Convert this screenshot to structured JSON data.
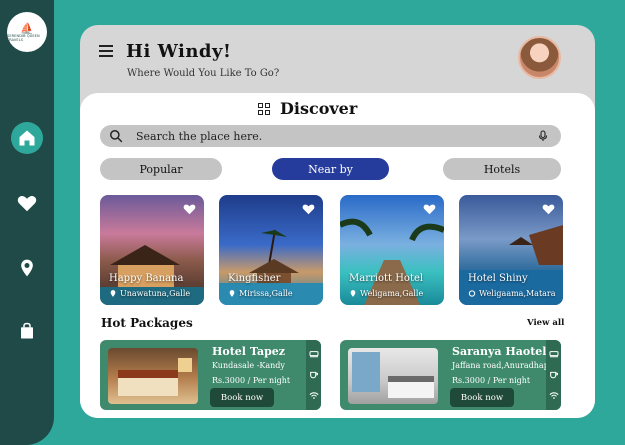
{
  "app": {
    "logo_text": "SERENDIB QUEEN TRAVELS",
    "logo_glyph": "⛵"
  },
  "sidebar": {
    "items": [
      {
        "name": "home-icon",
        "active": true
      },
      {
        "name": "heart-icon",
        "active": false
      },
      {
        "name": "location-icon",
        "active": false
      },
      {
        "name": "bag-icon",
        "active": false
      }
    ]
  },
  "header": {
    "greeting": "Hi  Windy!",
    "subtitle": "Where Would You Like To Go?"
  },
  "discover": {
    "title": "Discover"
  },
  "search": {
    "placeholder": "Search the place here."
  },
  "tabs": [
    {
      "label": "Popular",
      "active": false
    },
    {
      "label": "Near by",
      "active": true
    },
    {
      "label": "Hotels",
      "active": false
    }
  ],
  "places": [
    {
      "name": "Happy Banana",
      "location": "Unawatuna,Galle"
    },
    {
      "name": "Kingfisher",
      "location": "Mirissa,Galle"
    },
    {
      "name": "Marriott Hotel",
      "location": "Weligama,Galle"
    },
    {
      "name": "Hotel Shiny",
      "location": "Weligaama,Matara"
    }
  ],
  "hot_packages": {
    "title": "Hot Packages",
    "view_all": "View all",
    "items": [
      {
        "name": "Hotel Tapez",
        "location": "Kundasale -Kandy",
        "price": "Rs.3000 / Per night",
        "button": "Book now"
      },
      {
        "name": "Saranya Haotel",
        "location": "Jaffana road,Anuradhapura",
        "price": "Rs.3000 / Per night",
        "button": "Book now"
      }
    ]
  },
  "colors": {
    "background": "#2fa89c",
    "sidebar": "#1f4a47",
    "active_tab": "#263c9c",
    "package_card": "#3f8a6d"
  }
}
